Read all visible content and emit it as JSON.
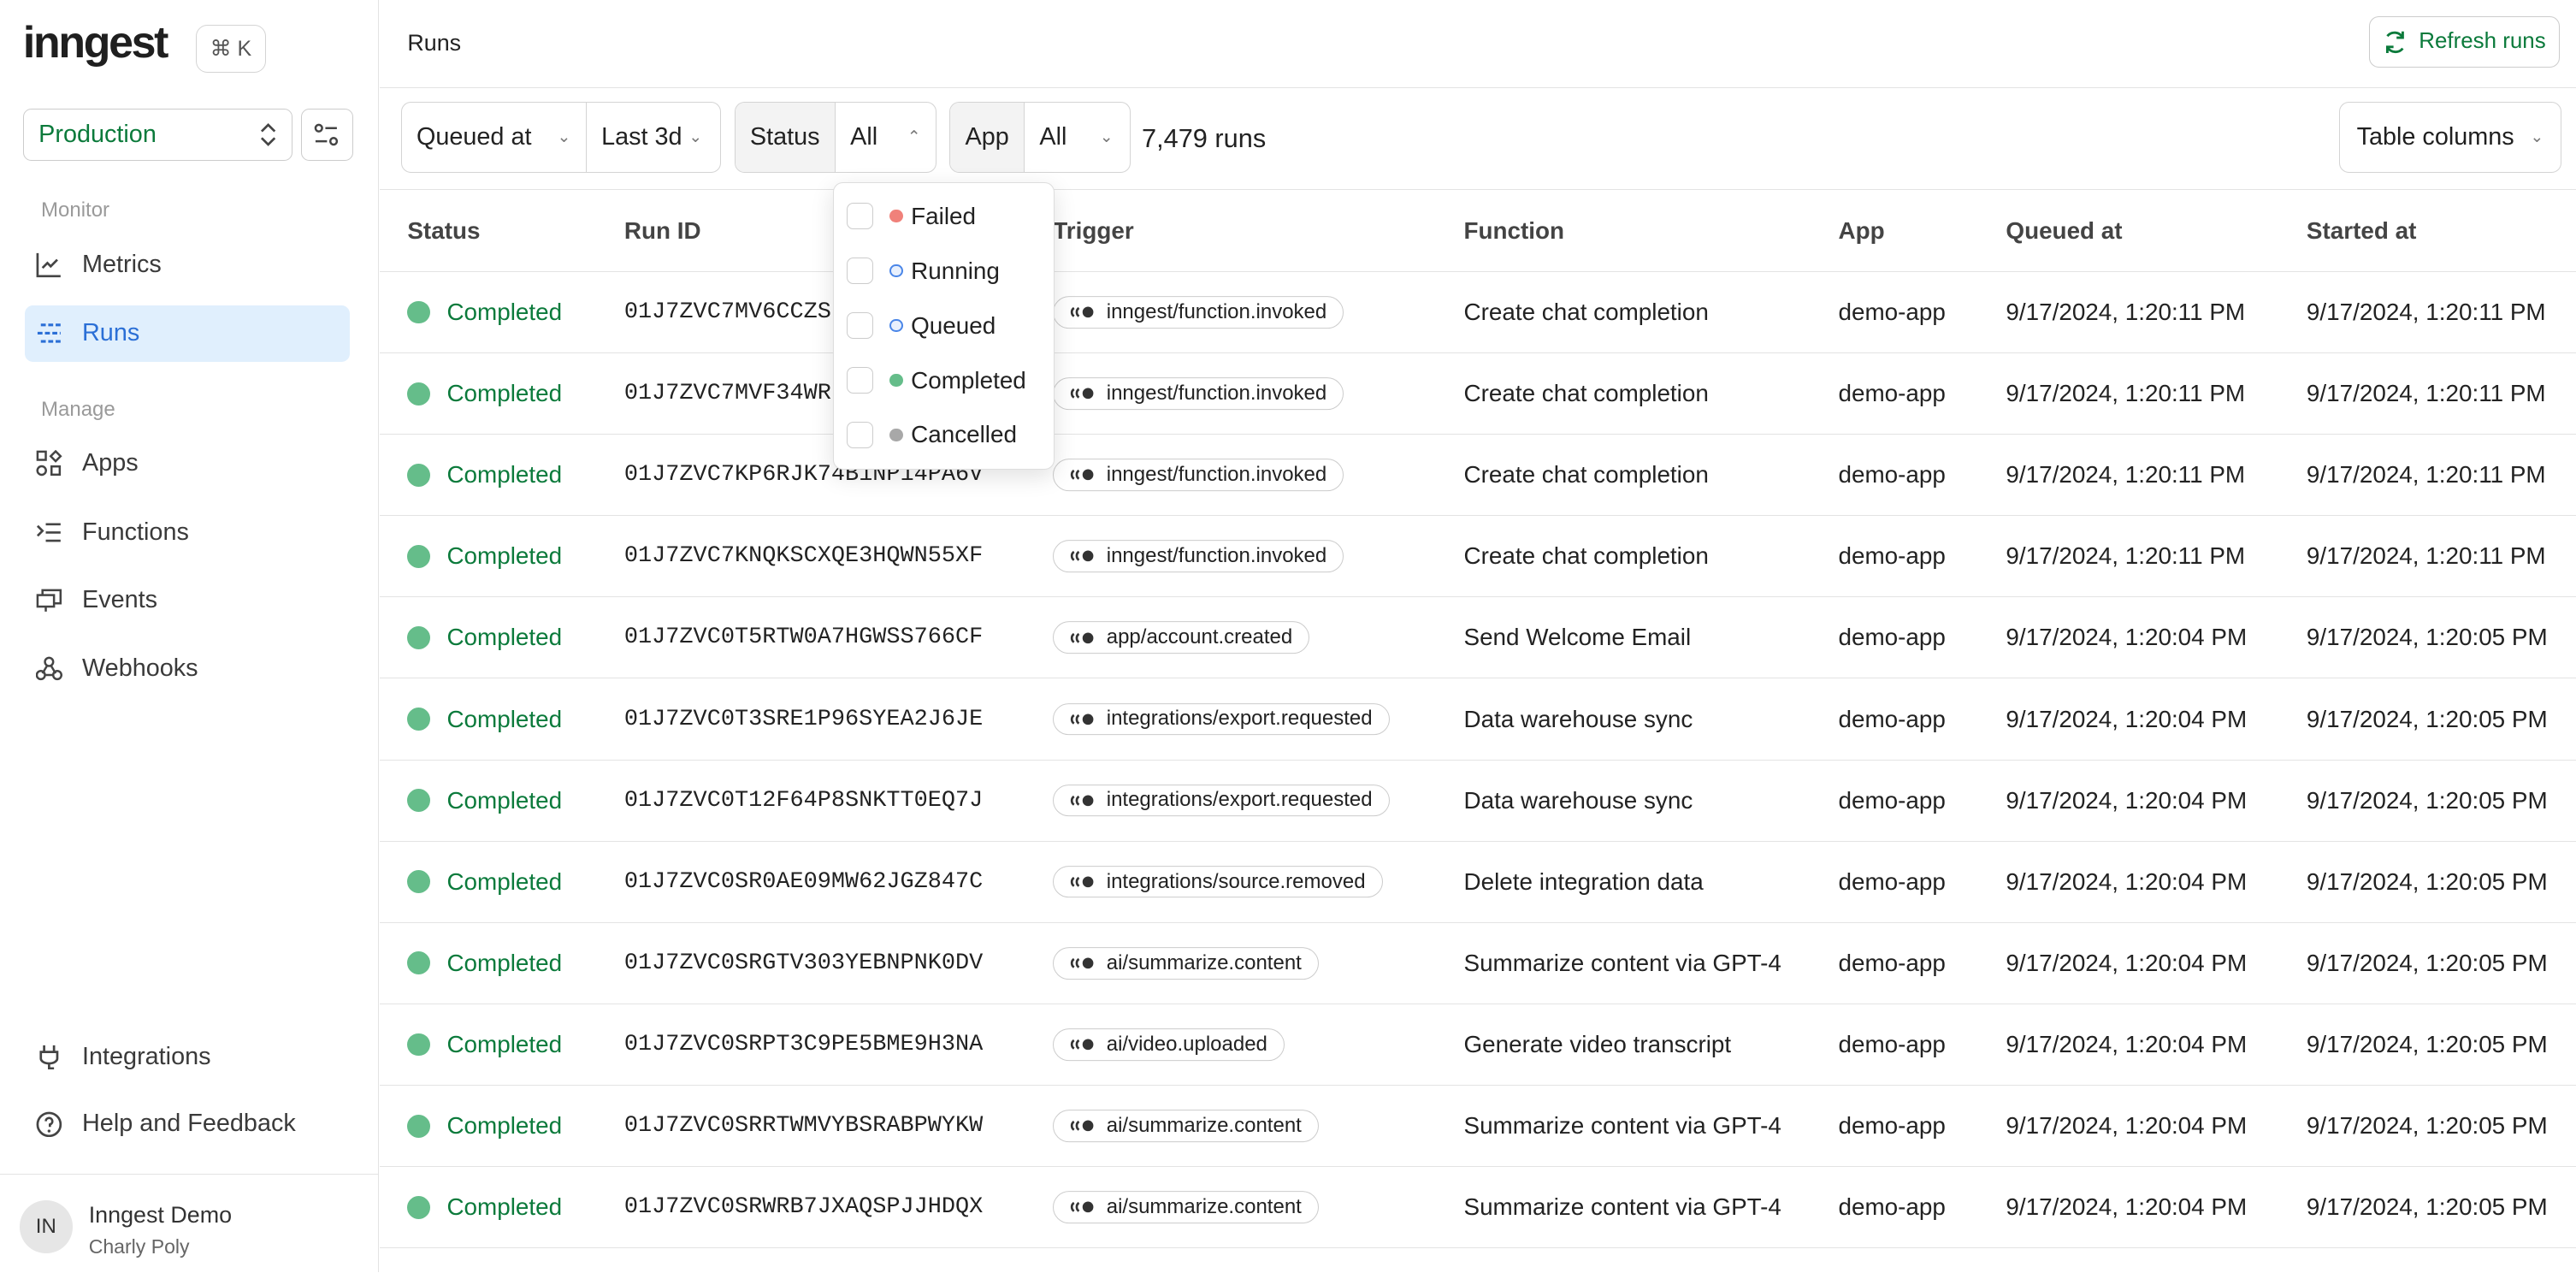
{
  "sidebar": {
    "logo": "inngest",
    "shortcut": "⌘ K",
    "environment": "Production",
    "sections": {
      "monitor": "Monitor",
      "manage": "Manage"
    },
    "items": [
      {
        "label": "Metrics",
        "icon": "chart-line-icon"
      },
      {
        "label": "Runs",
        "icon": "runs-list-icon",
        "active": true
      },
      {
        "label": "Apps",
        "icon": "apps-grid-icon"
      },
      {
        "label": "Functions",
        "icon": "functions-icon"
      },
      {
        "label": "Events",
        "icon": "events-icon"
      },
      {
        "label": "Webhooks",
        "icon": "webhook-icon"
      },
      {
        "label": "Integrations",
        "icon": "plug-icon"
      },
      {
        "label": "Help and Feedback",
        "icon": "help-circle-icon"
      }
    ],
    "user": {
      "initials": "IN",
      "name": "Inngest Demo",
      "sub": "Charly Poly"
    }
  },
  "header": {
    "title": "Runs",
    "refresh_label": "Refresh runs"
  },
  "filters": {
    "time_field": "Queued at",
    "time_range": "Last 3d",
    "status_label": "Status",
    "status_value": "All",
    "app_label": "App",
    "app_value": "All",
    "count": "7,479 runs",
    "table_columns": "Table columns"
  },
  "status_dropdown": [
    {
      "label": "Failed",
      "color": "#f0817a",
      "style": "filled"
    },
    {
      "label": "Running",
      "color": "#4a86e8",
      "style": "outline"
    },
    {
      "label": "Queued",
      "color": "#4a86e8",
      "style": "outline"
    },
    {
      "label": "Completed",
      "color": "#65bd8a",
      "style": "filled"
    },
    {
      "label": "Cancelled",
      "color": "#a8a8a8",
      "style": "filled"
    }
  ],
  "table": {
    "columns": [
      "Status",
      "Run ID",
      "Trigger",
      "Function",
      "App",
      "Queued at",
      "Started at"
    ],
    "rows": [
      {
        "status": "Completed",
        "run_id": "01J7ZVC7MV6CCZS",
        "trigger": "inngest/function.invoked",
        "function": "Create chat completion",
        "app": "demo-app",
        "queued": "9/17/2024, 1:20:11 PM",
        "started": "9/17/2024, 1:20:11 PM"
      },
      {
        "status": "Completed",
        "run_id": "01J7ZVC7MVF34WR",
        "trigger": "inngest/function.invoked",
        "function": "Create chat completion",
        "app": "demo-app",
        "queued": "9/17/2024, 1:20:11 PM",
        "started": "9/17/2024, 1:20:11 PM"
      },
      {
        "status": "Completed",
        "run_id": "01J7ZVC7KP6RJK74B1NP14PA6V",
        "trigger": "inngest/function.invoked",
        "function": "Create chat completion",
        "app": "demo-app",
        "queued": "9/17/2024, 1:20:11 PM",
        "started": "9/17/2024, 1:20:11 PM"
      },
      {
        "status": "Completed",
        "run_id": "01J7ZVC7KNQKSCXQE3HQWN55XF",
        "trigger": "inngest/function.invoked",
        "function": "Create chat completion",
        "app": "demo-app",
        "queued": "9/17/2024, 1:20:11 PM",
        "started": "9/17/2024, 1:20:11 PM"
      },
      {
        "status": "Completed",
        "run_id": "01J7ZVC0T5RTW0A7HGWSS766CF",
        "trigger": "app/account.created",
        "function": "Send Welcome Email",
        "app": "demo-app",
        "queued": "9/17/2024, 1:20:04 PM",
        "started": "9/17/2024, 1:20:05 PM"
      },
      {
        "status": "Completed",
        "run_id": "01J7ZVC0T3SRE1P96SYEA2J6JE",
        "trigger": "integrations/export.requested",
        "function": "Data warehouse sync",
        "app": "demo-app",
        "queued": "9/17/2024, 1:20:04 PM",
        "started": "9/17/2024, 1:20:05 PM"
      },
      {
        "status": "Completed",
        "run_id": "01J7ZVC0T12F64P8SNKTT0EQ7J",
        "trigger": "integrations/export.requested",
        "function": "Data warehouse sync",
        "app": "demo-app",
        "queued": "9/17/2024, 1:20:04 PM",
        "started": "9/17/2024, 1:20:05 PM"
      },
      {
        "status": "Completed",
        "run_id": "01J7ZVC0SR0AE09MW62JGZ847C",
        "trigger": "integrations/source.removed",
        "function": "Delete integration data",
        "app": "demo-app",
        "queued": "9/17/2024, 1:20:04 PM",
        "started": "9/17/2024, 1:20:05 PM"
      },
      {
        "status": "Completed",
        "run_id": "01J7ZVC0SRGTV303YEBNPNK0DV",
        "trigger": "ai/summarize.content",
        "function": "Summarize content via GPT-4",
        "app": "demo-app",
        "queued": "9/17/2024, 1:20:04 PM",
        "started": "9/17/2024, 1:20:05 PM"
      },
      {
        "status": "Completed",
        "run_id": "01J7ZVC0SRPT3C9PE5BME9H3NA",
        "trigger": "ai/video.uploaded",
        "function": "Generate video transcript",
        "app": "demo-app",
        "queued": "9/17/2024, 1:20:04 PM",
        "started": "9/17/2024, 1:20:05 PM"
      },
      {
        "status": "Completed",
        "run_id": "01J7ZVC0SRRTWMVYBSRABPWYKW",
        "trigger": "ai/summarize.content",
        "function": "Summarize content via GPT-4",
        "app": "demo-app",
        "queued": "9/17/2024, 1:20:04 PM",
        "started": "9/17/2024, 1:20:05 PM"
      },
      {
        "status": "Completed",
        "run_id": "01J7ZVC0SRWRB7JXAQSPJJHDQX",
        "trigger": "ai/summarize.content",
        "function": "Summarize content via GPT-4",
        "app": "demo-app",
        "queued": "9/17/2024, 1:20:04 PM",
        "started": "9/17/2024, 1:20:05 PM"
      }
    ]
  },
  "colors": {
    "accent_green": "#0b7a3b",
    "completed_dot": "#65bd8a",
    "active_nav_bg": "#e0effd",
    "active_nav_text": "#2b6fd6"
  }
}
